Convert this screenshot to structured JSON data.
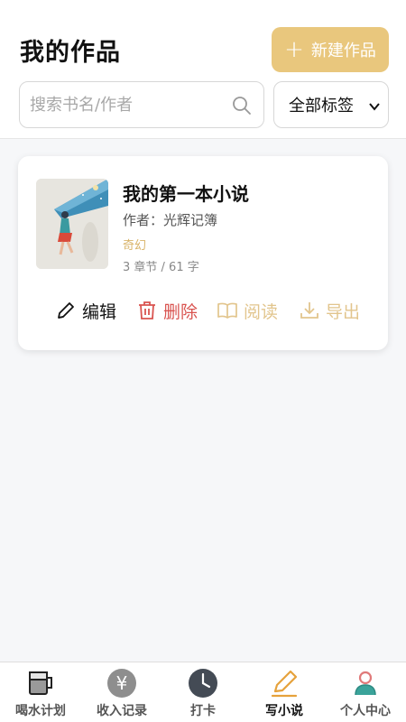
{
  "header": {
    "title": "我的作品",
    "new_button": "新建作品",
    "plus_glyph": "+",
    "search_placeholder": "搜索书名/作者",
    "tag_filter": "全部标签"
  },
  "colors": {
    "accent": "#e9c77d",
    "delete": "#d9534f",
    "muted_accent": "#e2c58d",
    "active_tab": "#e6a23c"
  },
  "works": [
    {
      "title": "我的第一本小说",
      "author": "作者：光辉记簿",
      "tag": "奇幻",
      "meta": "3 章节 / 61 字",
      "actions": {
        "edit": "编辑",
        "delete": "删除",
        "read": "阅读",
        "export": "导出"
      }
    }
  ],
  "tabbar": {
    "tabs": [
      {
        "label": "喝水计划",
        "icon": "mug-icon"
      },
      {
        "label": "收入记录",
        "icon": "yen-icon"
      },
      {
        "label": "打卡",
        "icon": "clock-icon"
      },
      {
        "label": "写小说",
        "icon": "pen-icon",
        "active": true
      },
      {
        "label": "个人中心",
        "icon": "user-icon"
      }
    ]
  }
}
